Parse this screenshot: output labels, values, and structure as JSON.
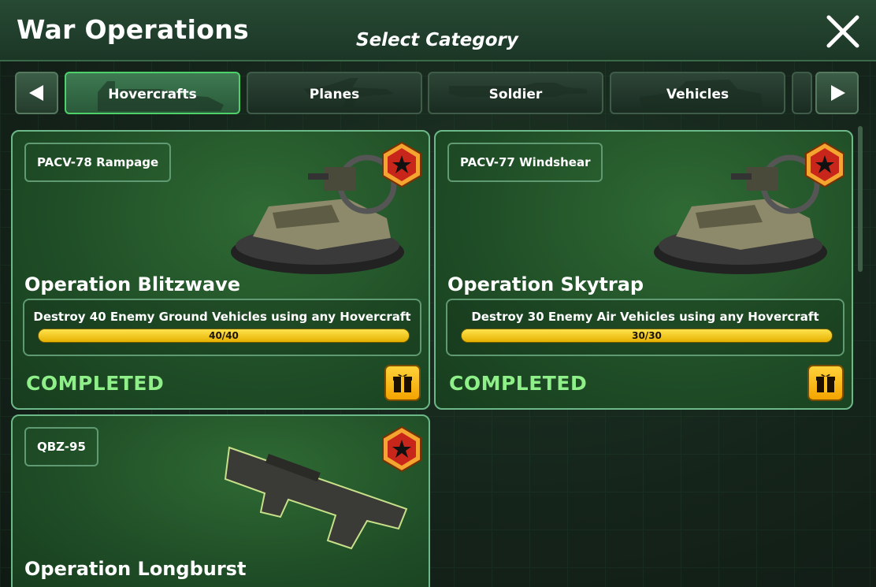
{
  "header": {
    "title": "War Operations",
    "subtitle": "Select Category",
    "close_icon": "close-icon"
  },
  "tabs": [
    {
      "label": "Hovercrafts",
      "active": true,
      "icon": "hovercraft-silhouette"
    },
    {
      "label": "Planes",
      "active": false,
      "icon": "plane-silhouette"
    },
    {
      "label": "Soldier",
      "active": false,
      "icon": "rifle-silhouette"
    },
    {
      "label": "Vehicles",
      "active": false,
      "icon": "tank-silhouette"
    }
  ],
  "nav": {
    "prev_icon": "arrow-left-icon",
    "next_icon": "arrow-right-icon"
  },
  "cards": [
    {
      "unit": "PACV-78 Rampage",
      "title": "Operation Blitzwave",
      "task": "Destroy 40 Enemy Ground Vehicles using any Hovercraft",
      "progress_text": "40/40",
      "progress": 1.0,
      "status": "COMPLETED",
      "image": "hovercraft"
    },
    {
      "unit": "PACV-77 Windshear",
      "title": "Operation Skytrap",
      "task": "Destroy 30 Enemy Air Vehicles using any Hovercraft",
      "progress_text": "30/30",
      "progress": 1.0,
      "status": "COMPLETED",
      "image": "hovercraft"
    },
    {
      "unit": "QBZ-95",
      "title": "Operation Longburst",
      "image": "assault-rifle"
    }
  ],
  "colors": {
    "accent_green": "#4fd16a",
    "completed_green": "#8ff08a",
    "progress_yellow": "#f0c000",
    "badge_red": "#c8261a",
    "badge_gold": "#f3a530"
  }
}
